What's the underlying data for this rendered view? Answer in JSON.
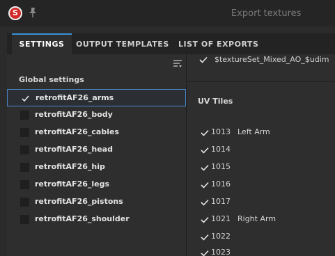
{
  "window": {
    "title": "Export textures"
  },
  "app": {
    "logo_text": "S"
  },
  "tabs": [
    {
      "label": "SETTINGS",
      "active": true
    },
    {
      "label": "OUTPUT TEMPLATES",
      "active": false
    },
    {
      "label": "LIST OF EXPORTS",
      "active": false
    }
  ],
  "left_panel": {
    "section_header": "Global settings",
    "items": [
      {
        "label": "retrofitAF26_arms",
        "checked": true,
        "selected": true
      },
      {
        "label": "retrofitAF26_body",
        "checked": false
      },
      {
        "label": "retrofitAF26_cables",
        "checked": false
      },
      {
        "label": "retrofitAF26_head",
        "checked": false
      },
      {
        "label": "retrofitAF26_hip",
        "checked": false
      },
      {
        "label": "retrofitAF26_legs",
        "checked": false
      },
      {
        "label": "retrofitAF26_pistons",
        "checked": false
      },
      {
        "label": "retrofitAF26_shoulder",
        "checked": false
      }
    ]
  },
  "right_panel": {
    "top_entry": {
      "text": "$textureSet_Mixed_AO_$udim",
      "checked": true
    },
    "uv_title": "UV Tiles",
    "uv_tiles": [
      {
        "num": "1013",
        "name": "Left Arm",
        "checked": true
      },
      {
        "num": "1014",
        "name": "",
        "checked": true
      },
      {
        "num": "1015",
        "name": "",
        "checked": true
      },
      {
        "num": "1016",
        "name": "",
        "checked": true
      },
      {
        "num": "1017",
        "name": "",
        "checked": true
      },
      {
        "num": "1021",
        "name": "Right Arm",
        "checked": true
      },
      {
        "num": "1022",
        "name": "",
        "checked": true
      },
      {
        "num": "1023",
        "name": "",
        "checked": true
      }
    ]
  },
  "colors": {
    "accent": "#3a8fd6",
    "logo": "#d22a2a",
    "background": "#2b2b2b"
  },
  "icons": {
    "pin": "pin-icon",
    "filter": "filter-icon",
    "check": "check-icon"
  }
}
